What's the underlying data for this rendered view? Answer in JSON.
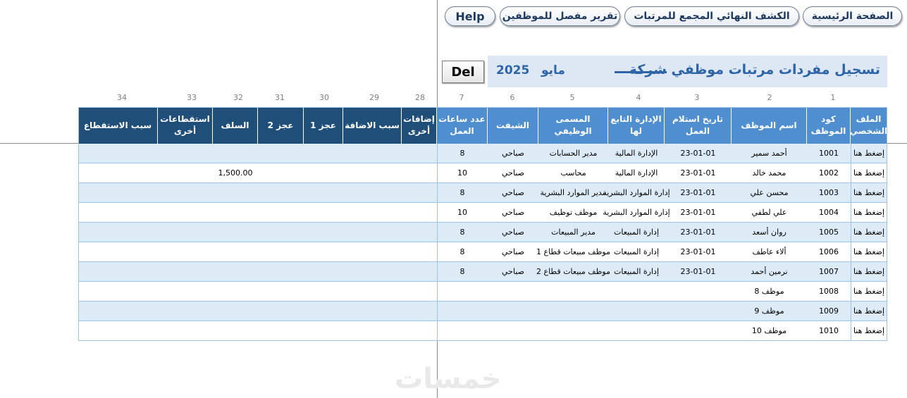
{
  "nav": {
    "home": "الصفحة الرئيسية",
    "final_report": "الكشف النهائي المجمع للمرتبات",
    "detailed_report": "تقرير مفصل للموظفين",
    "help": "Help"
  },
  "title": {
    "text": "تسجيل مفردات مرتبات موظفي شركة",
    "month": "مايو",
    "year": "2025"
  },
  "del_button": "Del",
  "column_numbers": [
    "1",
    "2",
    "3",
    "4",
    "5",
    "6",
    "7",
    "28",
    "29",
    "30",
    "31",
    "32",
    "33",
    "34"
  ],
  "headers": {
    "file": "الملف الشخصي",
    "code": "كود الموظف",
    "name": "اسم الموظف",
    "date": "تاريخ استلام العمل",
    "dept": "الإدارة التابع لها",
    "title": "المسمى الوظيفي",
    "shift": "الشيفت",
    "hours": "عدد ساعات العمل",
    "additions": "إضافات أخرى",
    "add_reason": "سبب الاضافة",
    "deficit1": "عجز 1",
    "deficit2": "عجز 2",
    "advances": "السلف",
    "deductions": "استقطاعات أخرى",
    "ded_reason": "سبب الاستقطاع"
  },
  "rows": [
    {
      "file": "إضغط هنا",
      "code": "1001",
      "name": "أحمد سمير",
      "date": "23-01-01",
      "dept": "الإدارة المالية",
      "title": "مدير الحسابات",
      "shift": "صباحي",
      "hours": "8",
      "advances": ""
    },
    {
      "file": "إضغط هنا",
      "code": "1002",
      "name": "محمد خالد",
      "date": "23-01-01",
      "dept": "الإدارة المالية",
      "title": "محاسب",
      "shift": "صباحي",
      "hours": "10",
      "advances": "1,500.00"
    },
    {
      "file": "إضغط هنا",
      "code": "1003",
      "name": "محسن علي",
      "date": "23-01-01",
      "dept": "إدارة الموارد البشرية",
      "title": "مدير الموارد البشرية",
      "shift": "صباحي",
      "hours": "8",
      "advances": ""
    },
    {
      "file": "إضغط هنا",
      "code": "1004",
      "name": "علي لطفي",
      "date": "23-01-01",
      "dept": "إدارة الموارد البشرية",
      "title": "موظف توظيف",
      "shift": "صباحي",
      "hours": "10",
      "advances": ""
    },
    {
      "file": "إضغط هنا",
      "code": "1005",
      "name": "روان أسعد",
      "date": "23-01-01",
      "dept": "إدارة المبيعات",
      "title": "مدير المبيعات",
      "shift": "صباحي",
      "hours": "8",
      "advances": ""
    },
    {
      "file": "إضغط هنا",
      "code": "1006",
      "name": "ألاء عاطف",
      "date": "23-01-01",
      "dept": "إدارة المبيعات",
      "title": "موظف مبيعات قطاع 1",
      "shift": "صباحي",
      "hours": "8",
      "advances": ""
    },
    {
      "file": "إضغط هنا",
      "code": "1007",
      "name": "نرمين أحمد",
      "date": "23-01-01",
      "dept": "إدارة المبيعات",
      "title": "موظف مبيعات قطاع 2",
      "shift": "صباحي",
      "hours": "8",
      "advances": ""
    },
    {
      "file": "إضغط هنا",
      "code": "1008",
      "name": "موظف 8",
      "date": "",
      "dept": "",
      "title": "",
      "shift": "",
      "hours": "",
      "advances": ""
    },
    {
      "file": "إضغط هنا",
      "code": "1009",
      "name": "موظف 9",
      "date": "",
      "dept": "",
      "title": "",
      "shift": "",
      "hours": "",
      "advances": ""
    },
    {
      "file": "إضغط هنا",
      "code": "1010",
      "name": "موظف 10",
      "date": "",
      "dept": "",
      "title": "",
      "shift": "",
      "hours": "",
      "advances": ""
    }
  ],
  "watermark": "خمسات",
  "colors": {
    "header_light": "#4f8fd0",
    "header_dark": "#1f4e79",
    "row_alt": "#ddebf7",
    "title_text": "#2e64a8"
  }
}
